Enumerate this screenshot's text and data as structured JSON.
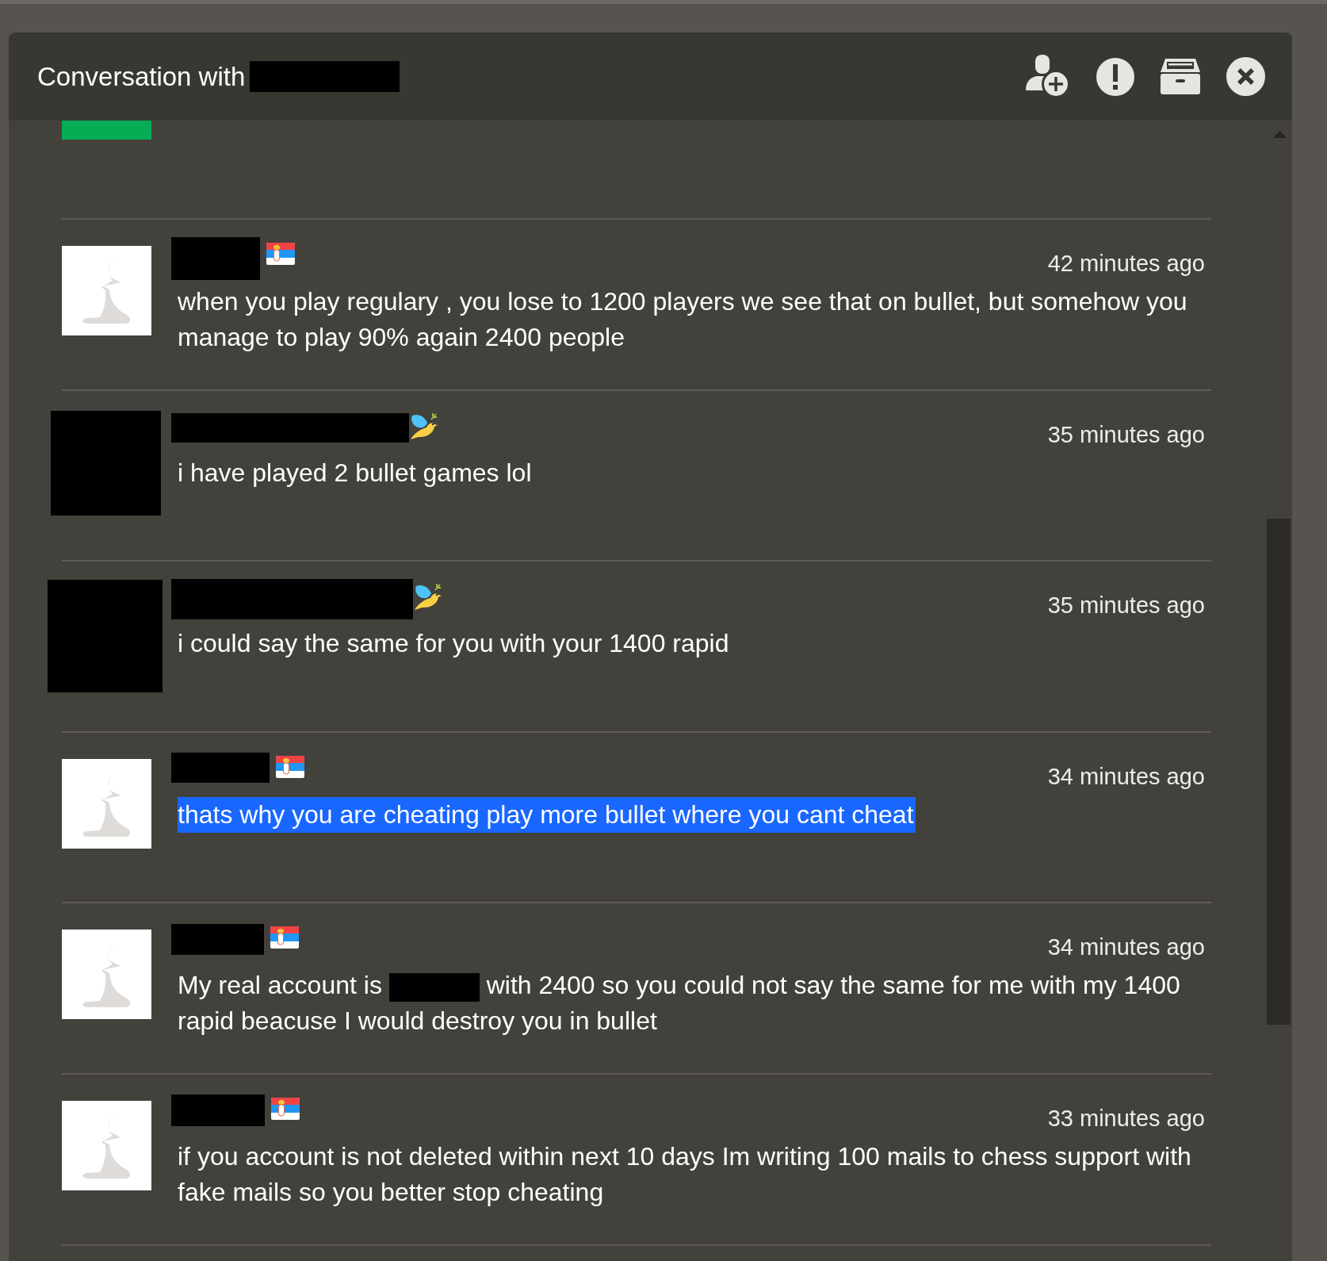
{
  "window": {
    "title": "Conversation with",
    "name_redacted": true
  },
  "partial_message": {
    "avatar": {
      "kind": "image"
    }
  },
  "messages": [
    {
      "avatar": {
        "kind": "default"
      },
      "name_redacted": true,
      "badge": {
        "kind": "flag"
      },
      "time": "42 minutes ago",
      "text": "when you play regulary , you lose to 1200 players we see that on bullet, but somehow you manage to play 90% again 2400 people",
      "selected": false
    },
    {
      "avatar": {
        "kind": "redacted"
      },
      "name_redacted": true,
      "badge": {
        "kind": "bird"
      },
      "time": "35 minutes ago",
      "text": "i have played 2 bullet games lol",
      "selected": false
    },
    {
      "avatar": {
        "kind": "redacted"
      },
      "name_redacted": true,
      "badge": {
        "kind": "bird"
      },
      "time": "35 minutes ago",
      "text": "i could say the same for you with your 1400 rapid",
      "selected": false
    },
    {
      "avatar": {
        "kind": "default"
      },
      "name_redacted": true,
      "badge": {
        "kind": "flag"
      },
      "time": "34 minutes ago",
      "text": "thats why you are cheating play more bullet where you cant cheat",
      "selected": true
    },
    {
      "avatar": {
        "kind": "default"
      },
      "name_redacted": true,
      "badge": {
        "kind": "flag"
      },
      "time": "34 minutes ago",
      "parts": [
        {
          "kind": "text",
          "text": "My real account is"
        },
        {
          "kind": "redacted"
        },
        {
          "kind": "text",
          "text": "with 2400 so you could not say the same for me with my 1400 rapid beacuse I would destroy you in bullet"
        }
      ],
      "selected": false
    },
    {
      "avatar": {
        "kind": "default"
      },
      "name_redacted": true,
      "badge": {
        "kind": "flag"
      },
      "time": "33 minutes ago",
      "text": "if you account is not deleted within next 10 days Im writing 100 mails to chess support with fake mails so you better stop cheating",
      "selected": false
    }
  ]
}
